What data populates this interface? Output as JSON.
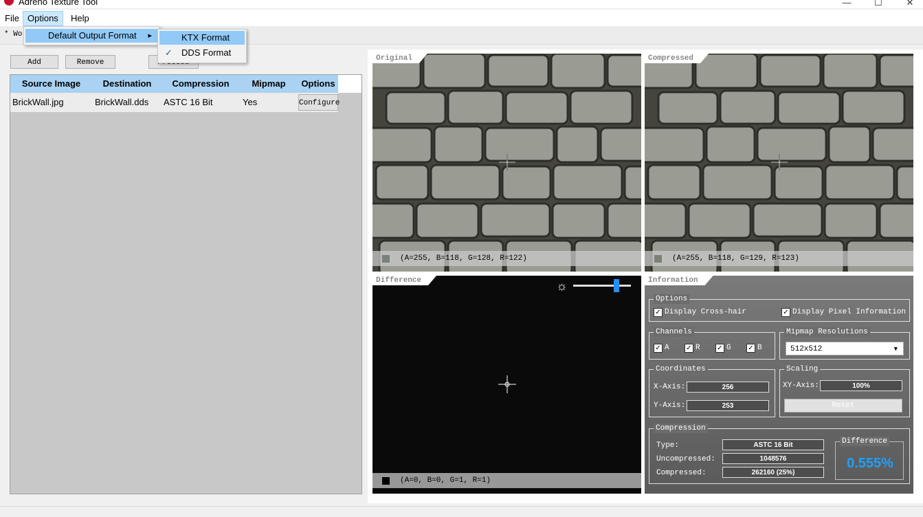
{
  "window": {
    "title": "Adreno Texture Tool",
    "minimize": "—",
    "maximize": "☐",
    "close": "✕"
  },
  "menubar": {
    "file": "File",
    "options": "Options",
    "help": "Help"
  },
  "options_menu": {
    "item": "Default Output Format",
    "arrow": "▸"
  },
  "format_submenu": {
    "ktx": "KTX Format",
    "dds": "DDS Format",
    "checkmark": "✓",
    "selected": "DDS Format"
  },
  "tab": {
    "label": "* Wo"
  },
  "toolbar": {
    "add": "Add",
    "remove": "Remove",
    "process": "Process"
  },
  "table": {
    "headers": [
      "Source Image",
      "Destination",
      "Compression",
      "Mipmap",
      "Options"
    ],
    "rows": [
      {
        "source": "BrickWall.jpg",
        "destination": "BrickWall.dds",
        "compression": "ASTC 16 Bit",
        "mipmap": "Yes",
        "options": "Configure"
      }
    ]
  },
  "original": {
    "label": "Original",
    "pixel": "(A=255, B=118, G=128, R=122)",
    "swatch": "#7a807a"
  },
  "compressed": {
    "label": "Compressed",
    "pixel": "(A=255, B=118, G=129, R=123)",
    "swatch": "#7b8176"
  },
  "difference": {
    "label": "Difference",
    "pixel": "(A=0, B=0, G=1, R=1)",
    "swatch": "#000000",
    "brightness_icon": "sun-icon",
    "brightness_level": 0.7
  },
  "information": {
    "label": "Information",
    "options": {
      "title": "Options",
      "crosshair": "Display Cross-hair",
      "pixel_info": "Display Pixel Information",
      "checked": "✓"
    },
    "channels": {
      "title": "Channels",
      "a": "A",
      "r": "R",
      "g": "G",
      "b": "B"
    },
    "mipmap": {
      "title": "Mipmap Resolutions",
      "value": "512x512",
      "arrow": "▼"
    },
    "coordinates": {
      "title": "Coordinates",
      "x_label": "X-Axis:",
      "x": "256",
      "y_label": "Y-Axis:",
      "y": "253"
    },
    "scaling": {
      "title": "Scaling",
      "xy_label": "XY-Axis:",
      "xy": "100%",
      "reset": "Reset"
    },
    "compression": {
      "title": "Compression",
      "type_label": "Type:",
      "type": "ASTC 16 Bit",
      "uncompressed_label": "Uncompressed:",
      "uncompressed": "1048576",
      "compressed_label": "Compressed:",
      "compressed": "262160 (25%)"
    },
    "difference": {
      "title": "Difference",
      "value": "0.555%"
    }
  },
  "colors": {
    "accent": "#1e90ff",
    "header": "#a9d2f3",
    "menu_highlight": "#91c9f7"
  }
}
